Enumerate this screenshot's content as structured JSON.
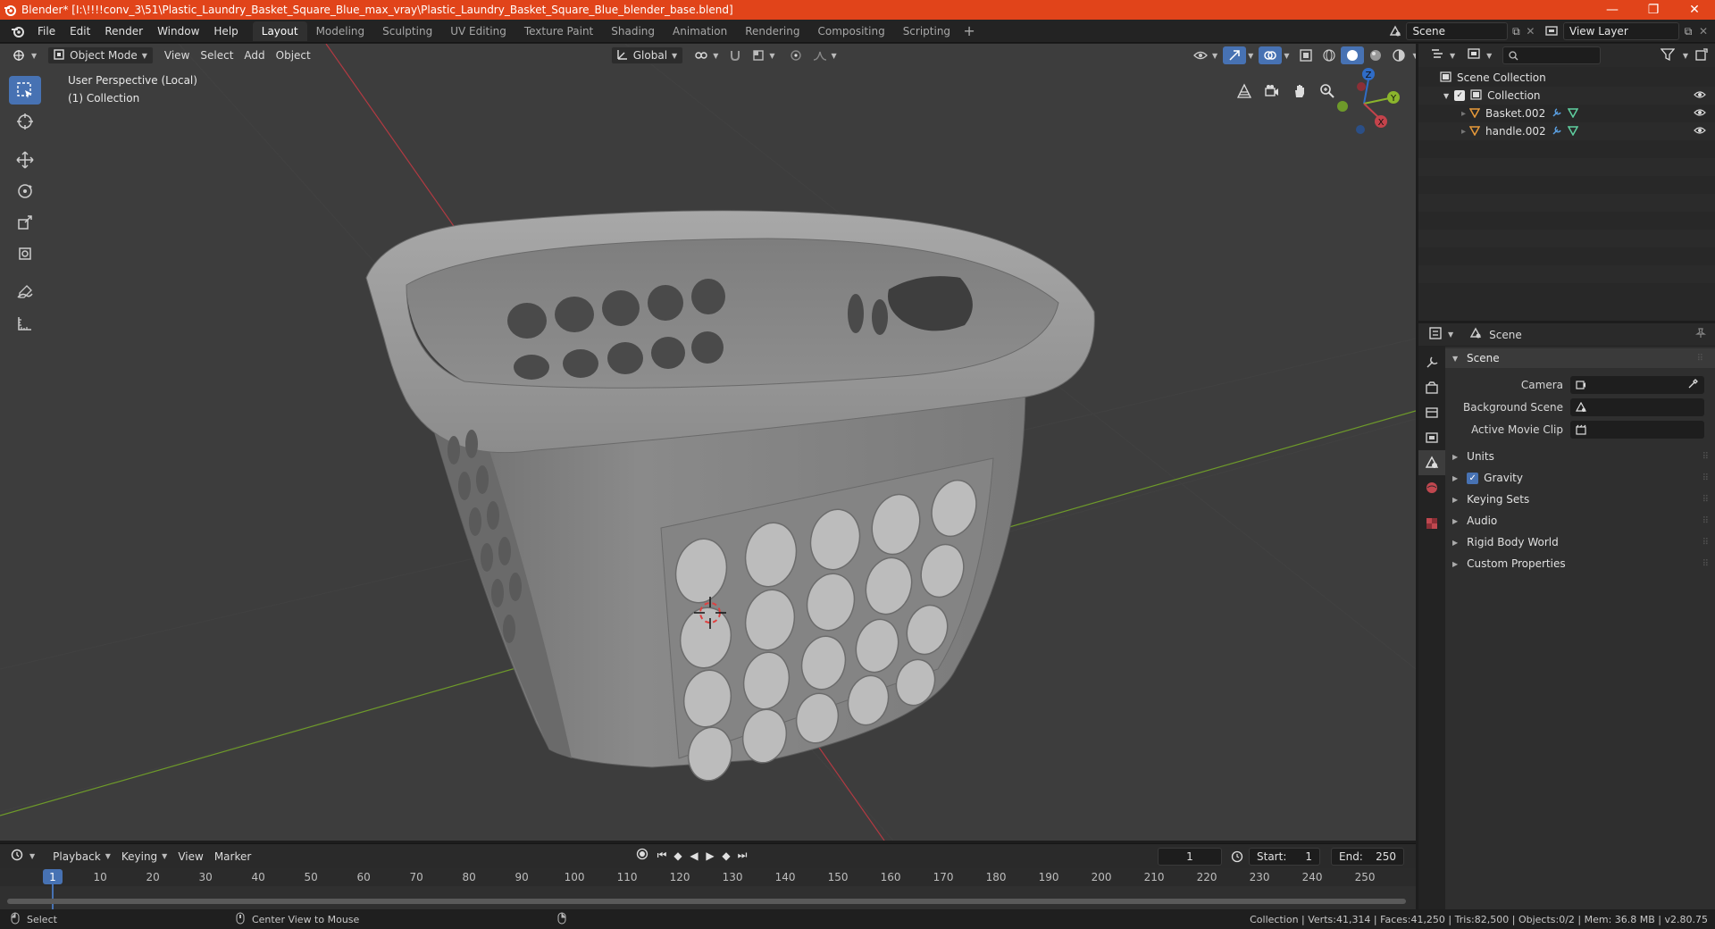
{
  "window": {
    "title": "Blender* [I:\\!!!!conv_3\\51\\Plastic_Laundry_Basket_Square_Blue_max_vray\\Plastic_Laundry_Basket_Square_Blue_blender_base.blend]",
    "minimize": "—",
    "maximize": "❐",
    "close": "✕"
  },
  "menu": [
    "File",
    "Edit",
    "Render",
    "Window",
    "Help"
  ],
  "workspaces": [
    "Layout",
    "Modeling",
    "Sculpting",
    "UV Editing",
    "Texture Paint",
    "Shading",
    "Animation",
    "Rendering",
    "Compositing",
    "Scripting"
  ],
  "active_workspace": "Layout",
  "scene_name": "Scene",
  "view_layer": "View Layer",
  "viewport_header": {
    "mode": "Object Mode",
    "menus": [
      "View",
      "Select",
      "Add",
      "Object"
    ],
    "orientation": "Global"
  },
  "viewport_info": {
    "line1": "User Perspective (Local)",
    "line2": "(1) Collection"
  },
  "gizmo": {
    "z": "Z",
    "y": "Y",
    "x": "X"
  },
  "outliner": {
    "root": "Scene Collection",
    "collection": "Collection",
    "objects": [
      "Basket.002",
      "handle.002"
    ]
  },
  "properties": {
    "header": "Scene",
    "panel": "Scene",
    "fields": [
      {
        "label": "Camera"
      },
      {
        "label": "Background Scene"
      },
      {
        "label": "Active Movie Clip"
      }
    ],
    "sections": [
      "Units",
      "Gravity",
      "Keying Sets",
      "Audio",
      "Rigid Body World",
      "Custom Properties"
    ],
    "gravity_enabled": true
  },
  "timeline": {
    "menus": [
      "Playback",
      "Keying",
      "View",
      "Marker"
    ],
    "current_frame": "1",
    "start_label": "Start:",
    "start": "1",
    "end_label": "End:",
    "end": "250",
    "ticks": [
      "1",
      "10",
      "20",
      "30",
      "40",
      "50",
      "60",
      "70",
      "80",
      "90",
      "100",
      "110",
      "120",
      "130",
      "140",
      "150",
      "160",
      "170",
      "180",
      "190",
      "200",
      "210",
      "220",
      "230",
      "240",
      "250"
    ]
  },
  "status": {
    "left_action": "Select",
    "mid_action": "Center View to Mouse",
    "stats": "Collection | Verts:41,314 | Faces:41,250 | Tris:82,500 | Objects:0/2 | Mem: 36.8 MB | v2.80.75"
  },
  "colors": {
    "title_bar": "#e1441a",
    "accent": "#4772b3",
    "viewport_bg": "#3d3d3d",
    "x_axis": "#c4434b",
    "y_axis": "#7aa22f"
  }
}
